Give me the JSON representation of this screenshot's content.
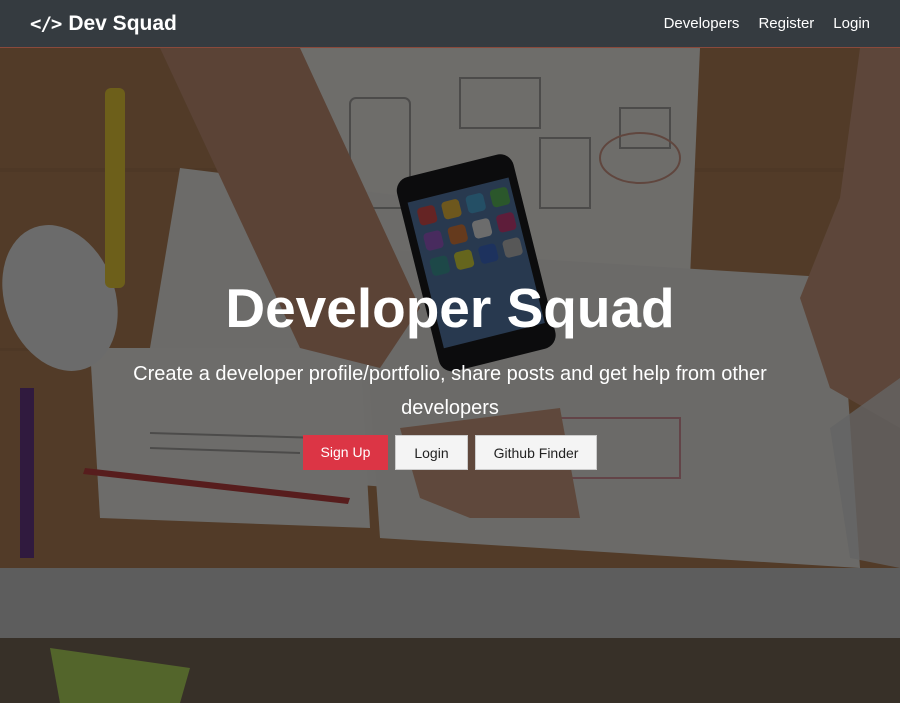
{
  "navbar": {
    "brand_icon": "</>",
    "brand_text": "Dev Squad",
    "links": [
      "Developers",
      "Register",
      "Login"
    ]
  },
  "hero": {
    "title": "Developer Squad",
    "lead": "Create a developer profile/portfolio, share posts and get help from other developers",
    "buttons": {
      "signup": "Sign Up",
      "login": "Login",
      "github": "Github Finder"
    }
  },
  "colors": {
    "navbar_bg": "#353b40",
    "primary": "#dc3545",
    "light": "#f4f4f4"
  }
}
